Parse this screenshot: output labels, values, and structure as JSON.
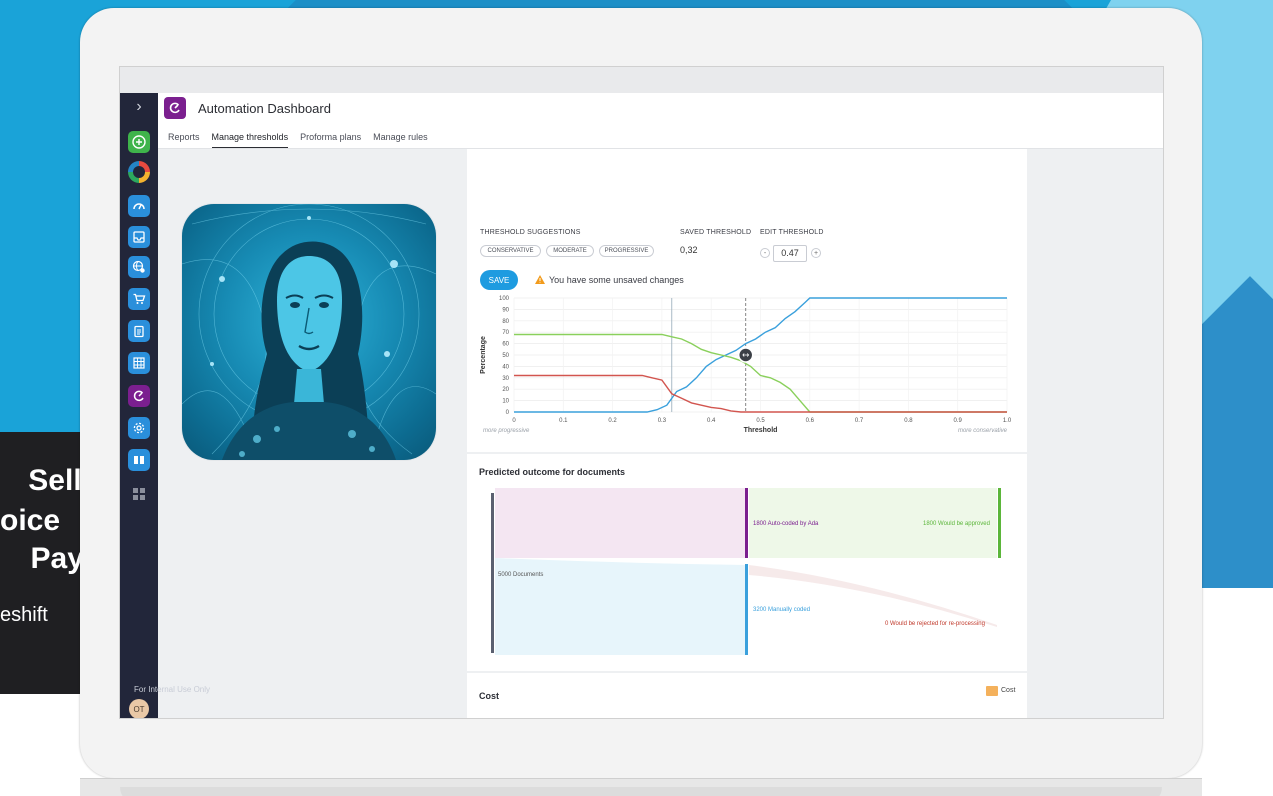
{
  "promo": {
    "line1": "Sell,",
    "line2": "oice",
    "line3": "Pay.",
    "line4": "eshift"
  },
  "app": {
    "title": "Automation Dashboard",
    "tabs": [
      {
        "label": "Reports",
        "active": false
      },
      {
        "label": "Manage thresholds",
        "active": true
      },
      {
        "label": "Proforma plans",
        "active": false
      },
      {
        "label": "Manage rules",
        "active": false
      }
    ]
  },
  "nav": {
    "icons": [
      "plus-icon",
      "ring-chart-icon",
      "speedometer-icon",
      "inbox-icon",
      "globe-settings-icon",
      "cart-icon",
      "clipboard-icon",
      "spreadsheet-icon",
      "automation-icon",
      "settings-icon",
      "book-icon",
      "apps-grid-icon"
    ],
    "footer_text": "For Internal Use Only",
    "avatar_initials": "OT"
  },
  "thresholds": {
    "suggestions_label": "THRESHOLD SUGGESTIONS",
    "saved_label": "SAVED THRESHOLD",
    "edit_label": "EDIT THRESHOLD",
    "suggestions": [
      "CONSERVATIVE",
      "MODERATE",
      "PROGRESSIVE"
    ],
    "saved_value": "0,32",
    "edit_value": "0.47",
    "decrement": "-",
    "increment": "+",
    "save_label": "SAVE",
    "warning_text": "You have some unsaved changes"
  },
  "chart_data": {
    "type": "line",
    "xlabel": "Threshold",
    "ylabel": "Percentage",
    "xlim": [
      0,
      1
    ],
    "ylim": [
      0,
      100
    ],
    "x_ticks": [
      "0",
      "0.1",
      "0.2",
      "0.3",
      "0.4",
      "0.5",
      "0.6",
      "0.7",
      "0.8",
      "0.9",
      "1.0"
    ],
    "y_ticks": [
      "0",
      "10",
      "20",
      "30",
      "40",
      "50",
      "60",
      "70",
      "80",
      "90",
      "100"
    ],
    "left_hint": "more progressive",
    "right_hint": "more conservative",
    "saved_threshold": 0.32,
    "edit_threshold": 0.47,
    "series": [
      {
        "color": "#3aa0dc",
        "x": [
          0,
          0.27,
          0.29,
          0.31,
          0.33,
          0.35,
          0.37,
          0.39,
          0.41,
          0.43,
          0.45,
          0.47,
          0.49,
          0.51,
          0.53,
          0.55,
          0.57,
          0.59,
          0.6,
          0.7,
          0.8,
          0.9,
          1.0
        ],
        "y": [
          0,
          0,
          2,
          6,
          18,
          22,
          30,
          40,
          46,
          50,
          54,
          60,
          64,
          70,
          74,
          82,
          88,
          96,
          100,
          100,
          100,
          100,
          100
        ]
      },
      {
        "color": "#8ad05c",
        "x": [
          0,
          0.1,
          0.2,
          0.3,
          0.32,
          0.34,
          0.36,
          0.38,
          0.4,
          0.42,
          0.44,
          0.46,
          0.48,
          0.5,
          0.52,
          0.54,
          0.56,
          0.58,
          0.6,
          0.7,
          0.8,
          0.9,
          1.0
        ],
        "y": [
          68,
          68,
          68,
          68,
          66,
          64,
          60,
          55,
          52,
          50,
          48,
          45,
          40,
          32,
          30,
          26,
          20,
          10,
          0,
          0,
          0,
          0,
          0
        ]
      },
      {
        "color": "#d2554f",
        "x": [
          0,
          0.1,
          0.2,
          0.26,
          0.28,
          0.3,
          0.32,
          0.34,
          0.36,
          0.38,
          0.4,
          0.42,
          0.44,
          0.46,
          0.48,
          0.5,
          0.6,
          0.7,
          0.8,
          0.9,
          1.0
        ],
        "y": [
          32,
          32,
          32,
          32,
          30,
          28,
          16,
          12,
          8,
          6,
          4,
          3,
          1,
          0,
          0,
          0,
          0,
          0,
          0,
          0,
          0
        ]
      }
    ]
  },
  "sankey": {
    "title": "Predicted outcome for documents",
    "source_label": "5000 Documents",
    "auto_label": "1800 Auto-coded by Ada",
    "manual_label": "3200 Manually coded",
    "approved_label": "1800 Would be approved",
    "rejected_label": "0 Would be rejected for re-processing",
    "colors": {
      "auto": "#7b1f8f",
      "manual": "#3aa0dc",
      "approved": "#5bb63a",
      "rejected": "#c0392b",
      "source": "#5a6070"
    }
  },
  "cost": {
    "title": "Cost",
    "legend_label": "Cost",
    "legend_color": "#f4b15c"
  }
}
